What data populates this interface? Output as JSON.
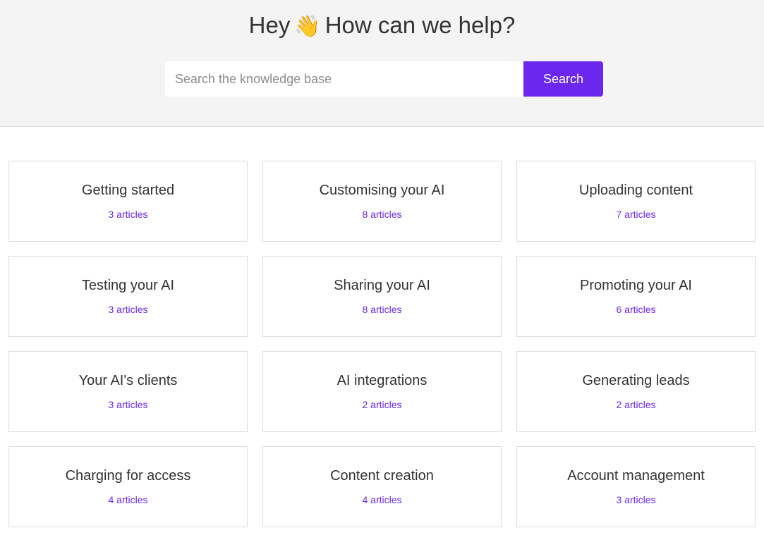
{
  "header": {
    "title_before": "Hey",
    "title_emoji": "👋",
    "title_after": "How can we help?"
  },
  "search": {
    "placeholder": "Search the knowledge base",
    "value": "",
    "button_label": "Search"
  },
  "colors": {
    "accent": "#6b27ee",
    "hero_background": "#f4f4f4"
  },
  "categories": [
    {
      "title": "Getting started",
      "count": "3 articles"
    },
    {
      "title": "Customising your AI",
      "count": "8 articles"
    },
    {
      "title": "Uploading content",
      "count": "7 articles"
    },
    {
      "title": "Testing your AI",
      "count": "3 articles"
    },
    {
      "title": "Sharing your AI",
      "count": "8 articles"
    },
    {
      "title": "Promoting your AI",
      "count": "6 articles"
    },
    {
      "title": "Your AI's clients",
      "count": "3 articles"
    },
    {
      "title": "AI integrations",
      "count": "2 articles"
    },
    {
      "title": "Generating leads",
      "count": "2 articles"
    },
    {
      "title": "Charging for access",
      "count": "4 articles"
    },
    {
      "title": "Content creation",
      "count": "4 articles"
    },
    {
      "title": "Account management",
      "count": "3 articles"
    }
  ]
}
